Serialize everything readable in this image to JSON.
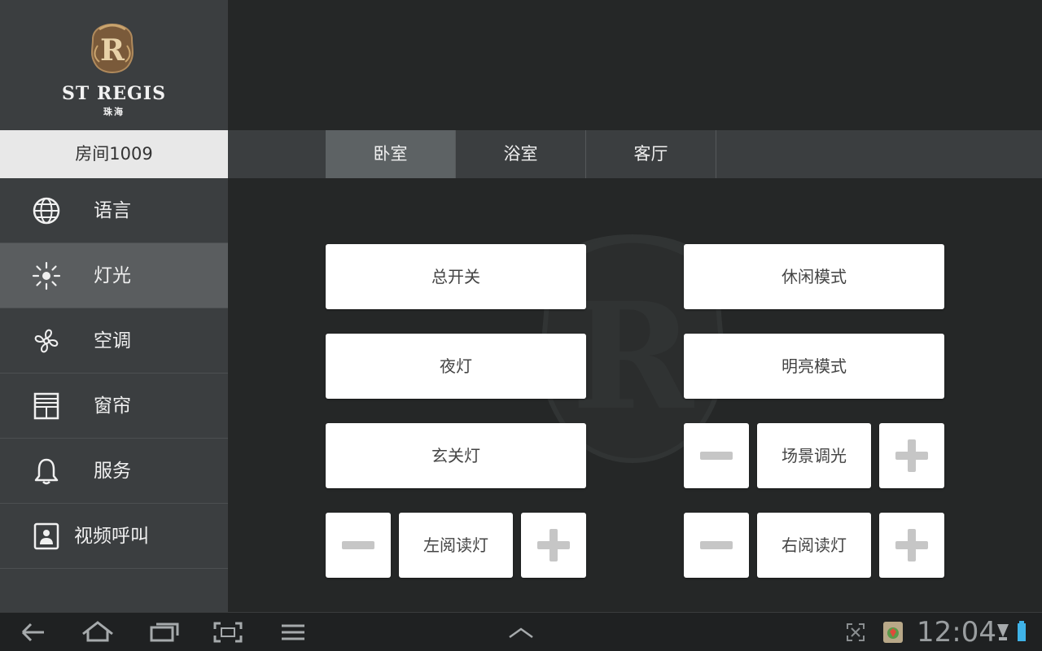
{
  "brand": {
    "name": "ST REGIS",
    "city": "珠海"
  },
  "room": {
    "label": "房间1009"
  },
  "sidebar": {
    "items": [
      {
        "label": "语言",
        "icon": "globe-icon"
      },
      {
        "label": "灯光",
        "icon": "sun-icon",
        "active": true
      },
      {
        "label": "空调",
        "icon": "fan-icon"
      },
      {
        "label": "窗帘",
        "icon": "curtain-icon"
      },
      {
        "label": "服务",
        "icon": "bell-icon"
      },
      {
        "label": "视频呼叫",
        "icon": "video-call-icon"
      }
    ]
  },
  "tabs": [
    {
      "label": "卧室",
      "active": true
    },
    {
      "label": "浴室"
    },
    {
      "label": "客厅"
    }
  ],
  "controls": {
    "master_switch": "总开关",
    "leisure_mode": "休闲模式",
    "night_light": "夜灯",
    "bright_mode": "明亮模式",
    "entrance_light": "玄关灯",
    "scene_dimming": "场景调光",
    "left_reading": "左阅读灯",
    "right_reading": "右阅读灯"
  },
  "status_bar": {
    "time": "12:04"
  },
  "colors": {
    "active_tab": "#5d6264",
    "active_nav": "#5a5d5f",
    "background": "#252727",
    "button": "#ffffff"
  }
}
